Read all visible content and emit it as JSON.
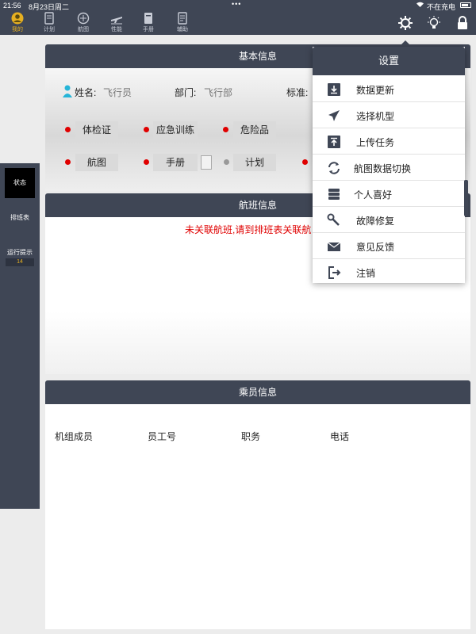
{
  "statusbar": {
    "time": "21:56",
    "date": "8月23日周二",
    "dots": "•••",
    "charging": "不在充电"
  },
  "nav": {
    "items": [
      {
        "label": "我的",
        "icon": "profile-icon"
      },
      {
        "label": "计划",
        "icon": "plan-icon"
      },
      {
        "label": "航图",
        "icon": "chart-map-icon"
      },
      {
        "label": "性能",
        "icon": "airplane-performance-icon"
      },
      {
        "label": "手册",
        "icon": "manual-icon"
      },
      {
        "label": "辅助",
        "icon": "assist-icon"
      }
    ],
    "active": "我的",
    "right_icons": [
      "gear-icon",
      "lightbulb-icon",
      "lock-icon"
    ]
  },
  "sidebar": {
    "items": [
      {
        "label": "状态"
      },
      {
        "label": "排班表"
      },
      {
        "label": "运行提示",
        "badge": "14"
      }
    ]
  },
  "basic_info": {
    "title": "基本信息",
    "name_label": "姓名:",
    "name_value": "飞行员",
    "dept_label": "部门:",
    "dept_value": "飞行部",
    "standard_label": "标准:",
    "tags_row1": [
      "体检证",
      "应急训练",
      "危险品"
    ],
    "tags_row2": [
      "航图",
      "手册",
      "计划"
    ]
  },
  "flight_info": {
    "title": "航班信息",
    "warning": "未关联航班,请到排班表关联航"
  },
  "crew_info": {
    "title": "乘员信息",
    "columns": [
      "机组成员",
      "员工号",
      "职务",
      "电话"
    ]
  },
  "settings_menu": {
    "title": "设置",
    "items": [
      {
        "label": "数据更新",
        "icon": "download-icon"
      },
      {
        "label": "选择机型",
        "icon": "airplane-icon"
      },
      {
        "label": "上传任务",
        "icon": "upload-icon"
      },
      {
        "label": "航图数据切换",
        "icon": "sync-icon"
      },
      {
        "label": "个人喜好",
        "icon": "preferences-icon"
      },
      {
        "label": "故障修复",
        "icon": "wrench-icon"
      },
      {
        "label": "意见反馈",
        "icon": "envelope-icon"
      },
      {
        "label": "注销",
        "icon": "logout-icon"
      }
    ]
  },
  "colors": {
    "nav_bg": "#3f4655",
    "accent": "#e6b021",
    "status_red": "#e00000"
  }
}
